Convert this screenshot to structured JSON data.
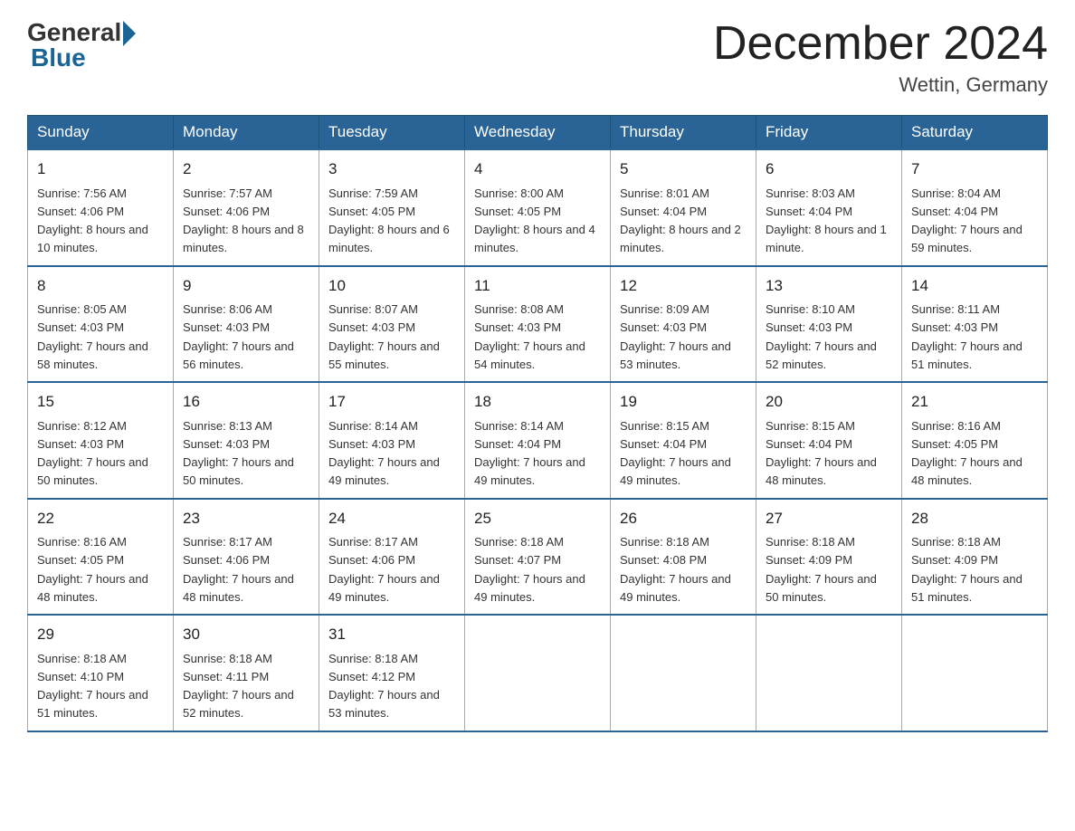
{
  "header": {
    "logo_general": "General",
    "logo_blue": "Blue",
    "title": "December 2024",
    "location": "Wettin, Germany"
  },
  "weekdays": [
    "Sunday",
    "Monday",
    "Tuesday",
    "Wednesday",
    "Thursday",
    "Friday",
    "Saturday"
  ],
  "weeks": [
    [
      {
        "day": "1",
        "sunrise": "7:56 AM",
        "sunset": "4:06 PM",
        "daylight": "8 hours and 10 minutes."
      },
      {
        "day": "2",
        "sunrise": "7:57 AM",
        "sunset": "4:06 PM",
        "daylight": "8 hours and 8 minutes."
      },
      {
        "day": "3",
        "sunrise": "7:59 AM",
        "sunset": "4:05 PM",
        "daylight": "8 hours and 6 minutes."
      },
      {
        "day": "4",
        "sunrise": "8:00 AM",
        "sunset": "4:05 PM",
        "daylight": "8 hours and 4 minutes."
      },
      {
        "day": "5",
        "sunrise": "8:01 AM",
        "sunset": "4:04 PM",
        "daylight": "8 hours and 2 minutes."
      },
      {
        "day": "6",
        "sunrise": "8:03 AM",
        "sunset": "4:04 PM",
        "daylight": "8 hours and 1 minute."
      },
      {
        "day": "7",
        "sunrise": "8:04 AM",
        "sunset": "4:04 PM",
        "daylight": "7 hours and 59 minutes."
      }
    ],
    [
      {
        "day": "8",
        "sunrise": "8:05 AM",
        "sunset": "4:03 PM",
        "daylight": "7 hours and 58 minutes."
      },
      {
        "day": "9",
        "sunrise": "8:06 AM",
        "sunset": "4:03 PM",
        "daylight": "7 hours and 56 minutes."
      },
      {
        "day": "10",
        "sunrise": "8:07 AM",
        "sunset": "4:03 PM",
        "daylight": "7 hours and 55 minutes."
      },
      {
        "day": "11",
        "sunrise": "8:08 AM",
        "sunset": "4:03 PM",
        "daylight": "7 hours and 54 minutes."
      },
      {
        "day": "12",
        "sunrise": "8:09 AM",
        "sunset": "4:03 PM",
        "daylight": "7 hours and 53 minutes."
      },
      {
        "day": "13",
        "sunrise": "8:10 AM",
        "sunset": "4:03 PM",
        "daylight": "7 hours and 52 minutes."
      },
      {
        "day": "14",
        "sunrise": "8:11 AM",
        "sunset": "4:03 PM",
        "daylight": "7 hours and 51 minutes."
      }
    ],
    [
      {
        "day": "15",
        "sunrise": "8:12 AM",
        "sunset": "4:03 PM",
        "daylight": "7 hours and 50 minutes."
      },
      {
        "day": "16",
        "sunrise": "8:13 AM",
        "sunset": "4:03 PM",
        "daylight": "7 hours and 50 minutes."
      },
      {
        "day": "17",
        "sunrise": "8:14 AM",
        "sunset": "4:03 PM",
        "daylight": "7 hours and 49 minutes."
      },
      {
        "day": "18",
        "sunrise": "8:14 AM",
        "sunset": "4:04 PM",
        "daylight": "7 hours and 49 minutes."
      },
      {
        "day": "19",
        "sunrise": "8:15 AM",
        "sunset": "4:04 PM",
        "daylight": "7 hours and 49 minutes."
      },
      {
        "day": "20",
        "sunrise": "8:15 AM",
        "sunset": "4:04 PM",
        "daylight": "7 hours and 48 minutes."
      },
      {
        "day": "21",
        "sunrise": "8:16 AM",
        "sunset": "4:05 PM",
        "daylight": "7 hours and 48 minutes."
      }
    ],
    [
      {
        "day": "22",
        "sunrise": "8:16 AM",
        "sunset": "4:05 PM",
        "daylight": "7 hours and 48 minutes."
      },
      {
        "day": "23",
        "sunrise": "8:17 AM",
        "sunset": "4:06 PM",
        "daylight": "7 hours and 48 minutes."
      },
      {
        "day": "24",
        "sunrise": "8:17 AM",
        "sunset": "4:06 PM",
        "daylight": "7 hours and 49 minutes."
      },
      {
        "day": "25",
        "sunrise": "8:18 AM",
        "sunset": "4:07 PM",
        "daylight": "7 hours and 49 minutes."
      },
      {
        "day": "26",
        "sunrise": "8:18 AM",
        "sunset": "4:08 PM",
        "daylight": "7 hours and 49 minutes."
      },
      {
        "day": "27",
        "sunrise": "8:18 AM",
        "sunset": "4:09 PM",
        "daylight": "7 hours and 50 minutes."
      },
      {
        "day": "28",
        "sunrise": "8:18 AM",
        "sunset": "4:09 PM",
        "daylight": "7 hours and 51 minutes."
      }
    ],
    [
      {
        "day": "29",
        "sunrise": "8:18 AM",
        "sunset": "4:10 PM",
        "daylight": "7 hours and 51 minutes."
      },
      {
        "day": "30",
        "sunrise": "8:18 AM",
        "sunset": "4:11 PM",
        "daylight": "7 hours and 52 minutes."
      },
      {
        "day": "31",
        "sunrise": "8:18 AM",
        "sunset": "4:12 PM",
        "daylight": "7 hours and 53 minutes."
      },
      null,
      null,
      null,
      null
    ]
  ]
}
